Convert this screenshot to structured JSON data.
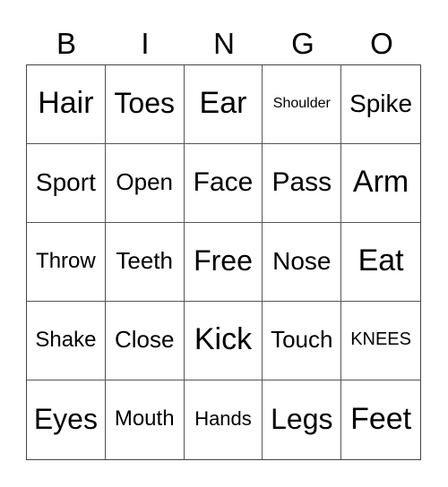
{
  "header": [
    "B",
    "I",
    "N",
    "G",
    "O"
  ],
  "cells": [
    [
      "Hair",
      "Toes",
      "Ear",
      "Shoulder",
      "Spike"
    ],
    [
      "Sport",
      "Open",
      "Face",
      "Pass",
      "Arm"
    ],
    [
      "Throw",
      "Teeth",
      "Free",
      "Nose",
      "Eat"
    ],
    [
      "Shake",
      "Close",
      "Kick",
      "Touch",
      "KNEES"
    ],
    [
      "Eyes",
      "Mouth",
      "Hands",
      "Legs",
      "Feet"
    ]
  ]
}
